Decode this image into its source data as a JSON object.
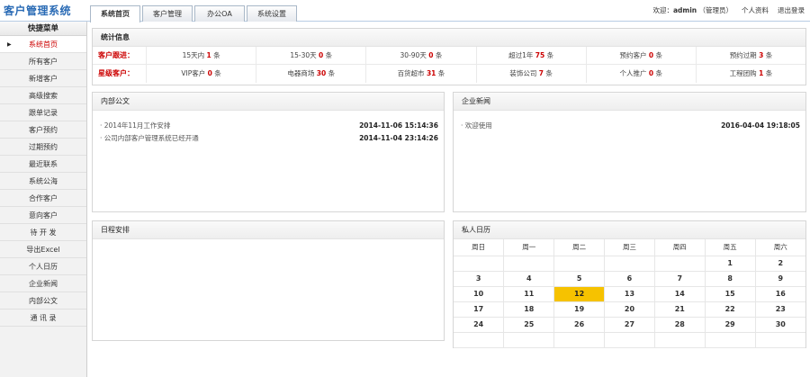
{
  "app": {
    "title": "客户管理系统"
  },
  "tabs": [
    {
      "label": "系统首页",
      "active": true
    },
    {
      "label": "客户管理",
      "active": false
    },
    {
      "label": "办公OA",
      "active": false
    },
    {
      "label": "系统设置",
      "active": false
    }
  ],
  "header": {
    "welcome_prefix": "欢迎：",
    "username": "admin",
    "role": "（管理员）",
    "profile_link": "个人资料",
    "logout_link": "退出登录"
  },
  "sidebar": {
    "title": "快捷菜单",
    "items": [
      {
        "label": "系统首页",
        "active": true
      },
      {
        "label": "所有客户"
      },
      {
        "label": "新增客户"
      },
      {
        "label": "高级搜索"
      },
      {
        "label": "跟单记录"
      },
      {
        "label": "客户预约"
      },
      {
        "label": "过期预约"
      },
      {
        "label": "最近联系"
      },
      {
        "label": "系统公海"
      },
      {
        "label": "合作客户"
      },
      {
        "label": "意向客户"
      },
      {
        "label": "待 开 发"
      },
      {
        "label": "导出Excel"
      },
      {
        "label": "个人日历"
      },
      {
        "label": "企业新闻"
      },
      {
        "label": "内部公文"
      },
      {
        "label": "通 讯 录"
      }
    ]
  },
  "stats": {
    "title": "统计信息",
    "rows": [
      {
        "label": "客户跟进：",
        "cells": [
          {
            "prefix": "15天内",
            "num": "1",
            "suffix": "条"
          },
          {
            "prefix": "15-30天",
            "num": "0",
            "suffix": "条"
          },
          {
            "prefix": "30-90天",
            "num": "0",
            "suffix": "条"
          },
          {
            "prefix": "超过1年",
            "num": "75",
            "suffix": "条"
          },
          {
            "prefix": "预约客户",
            "num": "0",
            "suffix": "条"
          },
          {
            "prefix": "预约过期",
            "num": "3",
            "suffix": "条"
          }
        ]
      },
      {
        "label": "星级客户：",
        "cells": [
          {
            "prefix": "VIP客户",
            "num": "0",
            "suffix": "条"
          },
          {
            "prefix": "电器商场",
            "num": "30",
            "suffix": "条"
          },
          {
            "prefix": "百货超市",
            "num": "31",
            "suffix": "条"
          },
          {
            "prefix": "装饰公司",
            "num": "7",
            "suffix": "条"
          },
          {
            "prefix": "个人推广",
            "num": "0",
            "suffix": "条"
          },
          {
            "prefix": "工程团购",
            "num": "1",
            "suffix": "条"
          }
        ]
      }
    ]
  },
  "docs": {
    "title": "内部公文",
    "items": [
      {
        "text": "· 2014年11月工作安排",
        "date": "2014-11-06 15:14:36"
      },
      {
        "text": "· 公司内部客户管理系统已经开通",
        "date": "2014-11-04 23:14:26"
      }
    ]
  },
  "news": {
    "title": "企业新闻",
    "items": [
      {
        "text": "· 欢迎使用",
        "date": "2016-04-04 19:18:05"
      }
    ]
  },
  "schedule": {
    "title": "日程安排"
  },
  "calendar": {
    "title": "私人日历",
    "weekdays": [
      "周日",
      "周一",
      "周二",
      "周三",
      "周四",
      "周五",
      "周六"
    ],
    "weeks": [
      [
        "",
        "",
        "",
        "",
        "",
        "1",
        "2"
      ],
      [
        "3",
        "4",
        "5",
        "6",
        "7",
        "8",
        "9"
      ],
      [
        "10",
        "11",
        "12",
        "13",
        "14",
        "15",
        "16"
      ],
      [
        "17",
        "18",
        "19",
        "20",
        "21",
        "22",
        "23"
      ],
      [
        "24",
        "25",
        "26",
        "27",
        "28",
        "29",
        "30"
      ],
      [
        "",
        "",
        "",
        "",
        "",
        "",
        ""
      ]
    ],
    "today": "12",
    "today_color": "#f6c200"
  },
  "colors": {
    "brand": "#2a6bb5",
    "alert": "#cc0000"
  }
}
